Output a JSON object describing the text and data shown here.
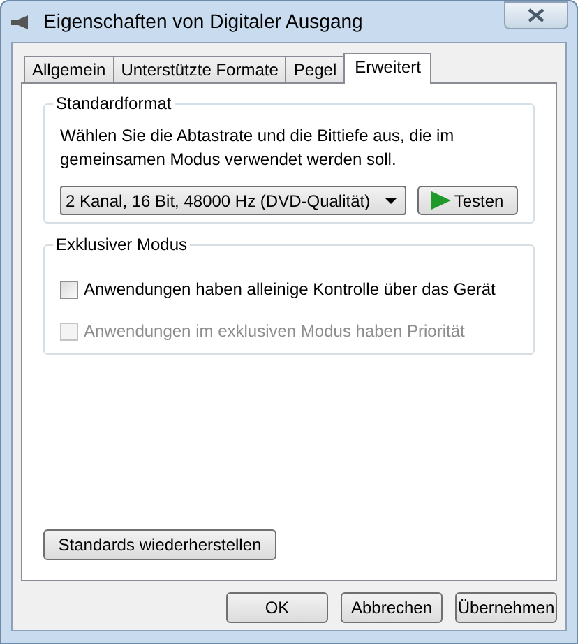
{
  "window": {
    "title": "Eigenschaften von Digitaler Ausgang"
  },
  "tabs": [
    {
      "label": "Allgemein",
      "selected": false
    },
    {
      "label": "Unterstützte Formate",
      "selected": false
    },
    {
      "label": "Pegel",
      "selected": false
    },
    {
      "label": "Erweitert",
      "selected": true
    }
  ],
  "standard_format": {
    "title": "Standardformat",
    "description": "Wählen Sie die Abtastrate und die Bittiefe aus, die im gemeinsamen Modus verwendet werden soll.",
    "format": "2 Kanal, 16 Bit, 48000 Hz (DVD-Qualität)",
    "test_button": "Testen"
  },
  "exclusive_mode": {
    "title": "Exklusiver Modus",
    "options": [
      {
        "label": "Anwendungen haben alleinige Kontrolle über das Gerät",
        "checked": false,
        "disabled": false
      },
      {
        "label": "Anwendungen im exklusiven Modus haben Priorität",
        "checked": false,
        "disabled": true
      }
    ]
  },
  "restore_button": "Standards wiederherstellen",
  "buttons": [
    "OK",
    "Abbrechen",
    "Übernehmen"
  ]
}
